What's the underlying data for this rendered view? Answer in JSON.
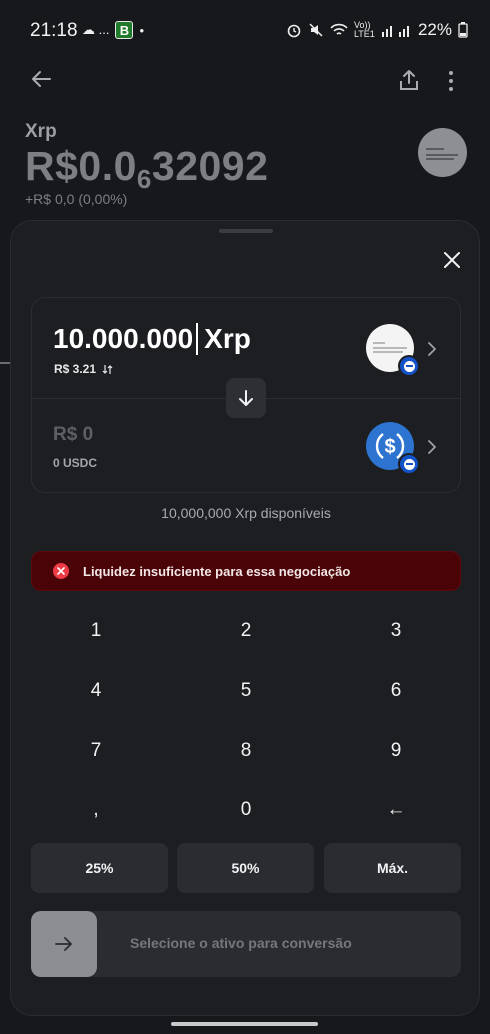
{
  "status_bar": {
    "time": "21:18",
    "left_glyphs": "☁ ...",
    "badge": "B",
    "dot": "•",
    "network": "Vo)) LTE1",
    "battery": "22%"
  },
  "asset": {
    "name": "Xrp",
    "price_prefix": "R$0.0",
    "price_sub": "6",
    "price_suffix": "32092",
    "change": "+R$ 0,0 (0,00%)"
  },
  "swap": {
    "from_amount": "10.000.000",
    "from_symbol": "Xrp",
    "from_fiat": "R$ 3.21",
    "to_amount_prefix": "R$",
    "to_amount": "0",
    "to_balance": "0 USDC"
  },
  "available_text": "10,000,000 Xrp disponíveis",
  "error_text": "Liquidez insuficiente para essa negociação",
  "keys": [
    "1",
    "2",
    "3",
    "4",
    "5",
    "6",
    "7",
    "8",
    "9",
    ",",
    "0",
    "←"
  ],
  "percent_buttons": [
    "25%",
    "50%",
    "Máx."
  ],
  "convert_label": "Selecione o ativo para conversão",
  "colors": {
    "sheet_bg": "#1d1e22",
    "error_bg": "#4a0407",
    "error_icon": "#ef3b46",
    "usdc_blue": "#2c74d0"
  }
}
